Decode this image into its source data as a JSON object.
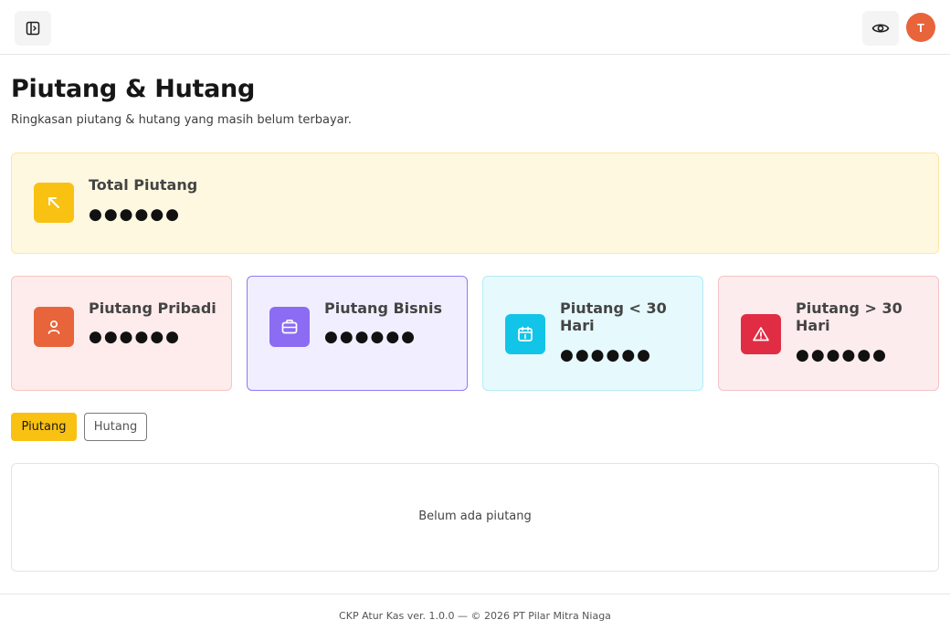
{
  "header": {
    "sidebar_toggle_icon": "sidebar-toggle-icon",
    "visibility_icon": "eye-icon",
    "avatar_initial": "T",
    "avatar_color": "#e8643a"
  },
  "page": {
    "title": "Piutang & Hutang",
    "subtitle": "Ringkasan piutang & hutang yang masih belum terbayar."
  },
  "total_card": {
    "label": "Total Piutang",
    "value": "●●●●●●",
    "icon": "arrow-up-left-icon",
    "accent": "#f9c111"
  },
  "cards": [
    {
      "label": "Piutang Pribadi",
      "value": "●●●●●●",
      "icon": "user-icon",
      "accent": "#e8643a"
    },
    {
      "label": "Piutang Bisnis",
      "value": "●●●●●●",
      "icon": "briefcase-icon",
      "accent": "#8b6cf2"
    },
    {
      "label": "Piutang < 30 Hari",
      "value": "●●●●●●",
      "icon": "calendar-icon",
      "accent": "#12c4e8"
    },
    {
      "label": "Piutang > 30 Hari",
      "value": "●●●●●●",
      "icon": "warning-icon",
      "accent": "#e02d44"
    }
  ],
  "tabs": [
    {
      "label": "Piutang",
      "active": true
    },
    {
      "label": "Hutang",
      "active": false
    }
  ],
  "empty_state": {
    "message": "Belum ada piutang"
  },
  "footer": {
    "text": "CKP Atur Kas ver. 1.0.0 — © 2026 PT Pilar Mitra Niaga"
  }
}
